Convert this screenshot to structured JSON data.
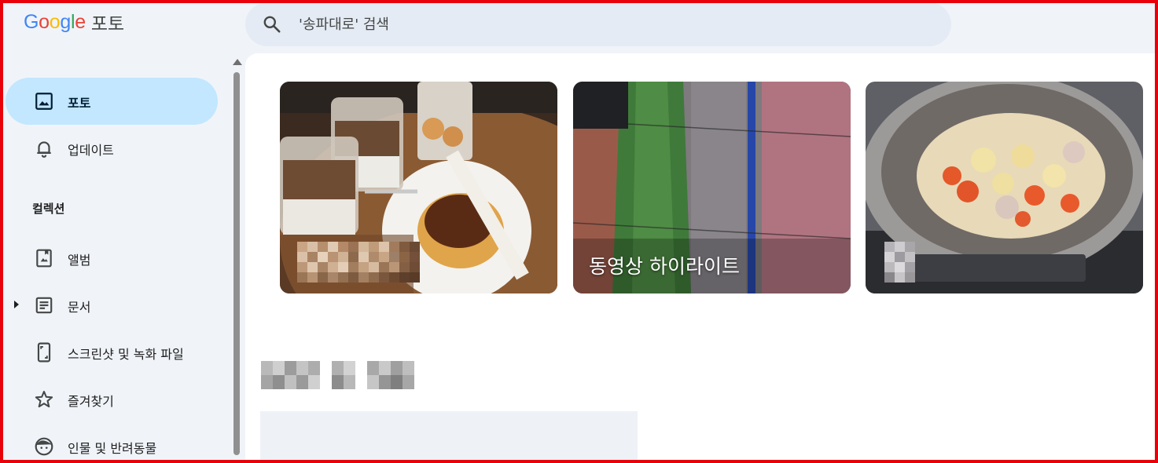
{
  "app": {
    "logo_text": [
      "G",
      "o",
      "o",
      "g",
      "l",
      "e"
    ],
    "product": "포토"
  },
  "search": {
    "placeholder": "'송파대로' 검색",
    "icon": "search-icon"
  },
  "sidebar": {
    "items": [
      {
        "label": "포토",
        "icon": "photo-icon",
        "active": true
      },
      {
        "label": "업데이트",
        "icon": "bell-icon",
        "active": false
      }
    ],
    "collections_heading": "컬렉션",
    "collections": [
      {
        "label": "앨범",
        "icon": "album-icon"
      },
      {
        "label": "문서",
        "icon": "document-icon",
        "expandable": true
      },
      {
        "label": "스크린샷 및 녹화 파일",
        "icon": "screenshot-icon"
      },
      {
        "label": "즐겨찾기",
        "icon": "star-icon"
      },
      {
        "label": "인물 및 반려동물",
        "icon": "face-icon"
      }
    ]
  },
  "memories": [
    {
      "title": "",
      "title_blurred": true,
      "image": "coffee-and-cheesecake-photo"
    },
    {
      "title": "동영상 하이라이트",
      "title_blurred": false,
      "image": "baseball-stadium-photo"
    },
    {
      "title": "",
      "title_blurred": true,
      "image": "stew-pot-photo"
    }
  ],
  "date_heading": {
    "text": "",
    "blurred": true
  },
  "colors": {
    "accent": "#c2e7ff",
    "frame": "#e8000b",
    "background": "#f0f4f9"
  }
}
